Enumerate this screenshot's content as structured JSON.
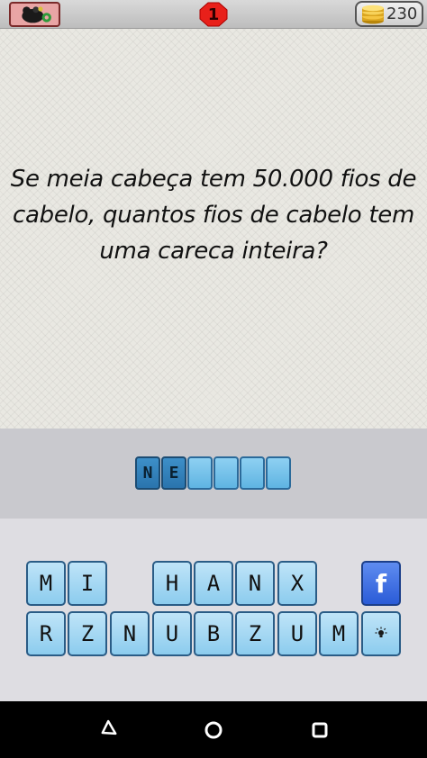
{
  "topbar": {
    "menu_icon": "brain-gears-icon",
    "level": "1",
    "coins": "230",
    "coin_icon": "coin-stack-icon"
  },
  "question": {
    "text": "Se meia cabeça tem 50.000 fios de cabelo, quantos fios de cabelo tem uma careca inteira?"
  },
  "answer": {
    "slots": [
      "N",
      "E",
      "",
      "",
      "",
      ""
    ]
  },
  "keyboard": {
    "row1": [
      "M",
      "I",
      "",
      "H",
      "A",
      "N",
      "X"
    ],
    "row2": [
      "R",
      "Z",
      "N",
      "U",
      "B",
      "Z",
      "U",
      "M"
    ],
    "facebook_label": "f",
    "hint_icon": "lightbulb-icon"
  },
  "navbar": {
    "back_icon": "back-triangle-icon",
    "home_icon": "home-circle-icon",
    "recents_icon": "recents-square-icon"
  },
  "colors": {
    "slot_filled": "#2a74ad",
    "slot_empty": "#5fb4e2",
    "key": "#8cccee",
    "facebook": "#2a5bd7",
    "level_badge": "#e8201a"
  }
}
